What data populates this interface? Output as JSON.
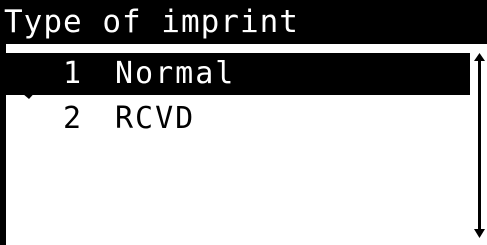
{
  "screen": {
    "title": "Type of imprint"
  },
  "menu": {
    "items": [
      {
        "number": "1",
        "label": "Normal",
        "selected": true,
        "checked": true
      },
      {
        "number": "2",
        "label": "RCVD",
        "selected": false,
        "checked": false
      }
    ]
  },
  "icons": {
    "check": "checkmark-icon",
    "scroll_up": "scroll-up-arrow-icon",
    "scroll_down": "scroll-down-arrow-icon"
  },
  "colors": {
    "foreground": "#000000",
    "background": "#ffffff"
  }
}
